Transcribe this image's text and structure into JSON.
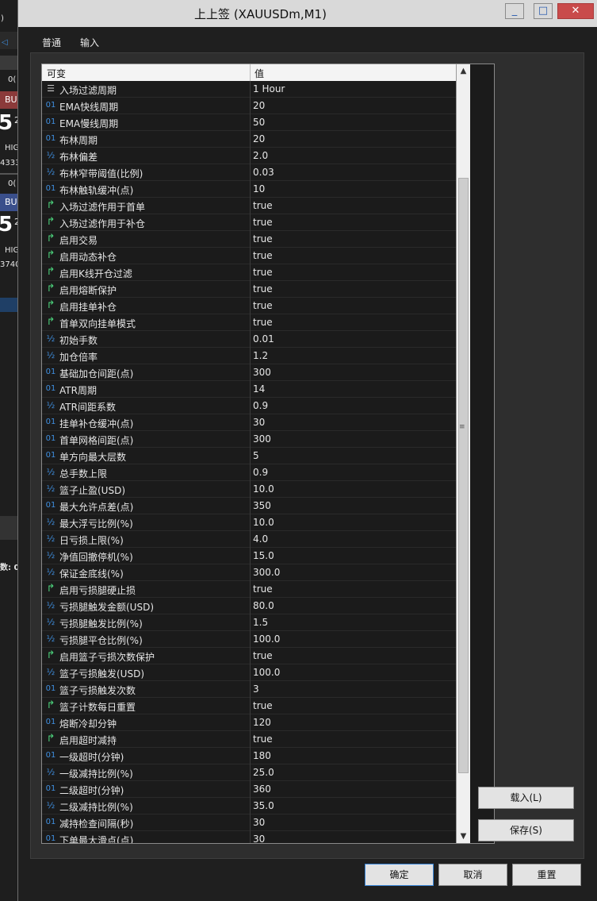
{
  "window": {
    "title": "上上签 (XAUUSDm,M1)",
    "controls": {
      "minimize": "_",
      "maximize": "□",
      "close": "✕"
    }
  },
  "background": {
    "items": [
      ")",
      "0(",
      "BU",
      "5",
      "2",
      "HIG",
      "4333",
      "0(",
      "BU",
      "5",
      "2",
      "HIG",
      "3740",
      "数: 0"
    ]
  },
  "tabs": [
    {
      "label": "普通"
    },
    {
      "label": "输入"
    }
  ],
  "grid": {
    "headers": {
      "name": "可变",
      "value": "值"
    },
    "rows": [
      {
        "icon": "enum",
        "name": "入场过滤周期",
        "value": "1 Hour"
      },
      {
        "icon": "int",
        "name": "EMA快线周期",
        "value": "20"
      },
      {
        "icon": "int",
        "name": "EMA慢线周期",
        "value": "50"
      },
      {
        "icon": "int",
        "name": "布林周期",
        "value": "20"
      },
      {
        "icon": "double",
        "name": "布林偏差",
        "value": "2.0"
      },
      {
        "icon": "double",
        "name": "布林窄带阈值(比例)",
        "value": "0.03"
      },
      {
        "icon": "int",
        "name": "布林触轨缓冲(点)",
        "value": "10"
      },
      {
        "icon": "bool",
        "name": "入场过滤作用于首单",
        "value": "true"
      },
      {
        "icon": "bool",
        "name": "入场过滤作用于补仓",
        "value": "true"
      },
      {
        "icon": "bool",
        "name": "启用交易",
        "value": "true"
      },
      {
        "icon": "bool",
        "name": "启用动态补仓",
        "value": "true"
      },
      {
        "icon": "bool",
        "name": "启用K线开仓过滤",
        "value": "true"
      },
      {
        "icon": "bool",
        "name": "启用熔断保护",
        "value": "true"
      },
      {
        "icon": "bool",
        "name": "启用挂单补仓",
        "value": "true"
      },
      {
        "icon": "bool",
        "name": "首单双向挂单模式",
        "value": "true"
      },
      {
        "icon": "double",
        "name": "初始手数",
        "value": "0.01"
      },
      {
        "icon": "double",
        "name": "加仓倍率",
        "value": "1.2"
      },
      {
        "icon": "int",
        "name": "基础加仓间距(点)",
        "value": "300"
      },
      {
        "icon": "int",
        "name": "ATR周期",
        "value": "14"
      },
      {
        "icon": "double",
        "name": "ATR间距系数",
        "value": "0.9"
      },
      {
        "icon": "int",
        "name": "挂单补仓缓冲(点)",
        "value": "30"
      },
      {
        "icon": "int",
        "name": "首单网格间距(点)",
        "value": "300"
      },
      {
        "icon": "int",
        "name": "单方向最大层数",
        "value": "5"
      },
      {
        "icon": "double",
        "name": "总手数上限",
        "value": "0.9"
      },
      {
        "icon": "double",
        "name": "篮子止盈(USD)",
        "value": "10.0"
      },
      {
        "icon": "int",
        "name": "最大允许点差(点)",
        "value": "350"
      },
      {
        "icon": "double",
        "name": "最大浮亏比例(%)",
        "value": "10.0"
      },
      {
        "icon": "double",
        "name": "日亏损上限(%)",
        "value": "4.0"
      },
      {
        "icon": "double",
        "name": "净值回撤停机(%)",
        "value": "15.0"
      },
      {
        "icon": "double",
        "name": "保证金底线(%)",
        "value": "300.0"
      },
      {
        "icon": "bool",
        "name": "启用亏损腿硬止损",
        "value": "true"
      },
      {
        "icon": "double",
        "name": "亏损腿触发金额(USD)",
        "value": "80.0"
      },
      {
        "icon": "double",
        "name": "亏损腿触发比例(%)",
        "value": "1.5"
      },
      {
        "icon": "double",
        "name": "亏损腿平仓比例(%)",
        "value": "100.0"
      },
      {
        "icon": "bool",
        "name": "启用篮子亏损次数保护",
        "value": "true"
      },
      {
        "icon": "double",
        "name": "篮子亏损触发(USD)",
        "value": "100.0"
      },
      {
        "icon": "int",
        "name": "篮子亏损触发次数",
        "value": "3"
      },
      {
        "icon": "bool",
        "name": "篮子计数每日重置",
        "value": "true"
      },
      {
        "icon": "int",
        "name": "熔断冷却分钟",
        "value": "120"
      },
      {
        "icon": "bool",
        "name": "启用超时减持",
        "value": "true"
      },
      {
        "icon": "int",
        "name": "一级超时(分钟)",
        "value": "180"
      },
      {
        "icon": "double",
        "name": "一级减持比例(%)",
        "value": "25.0"
      },
      {
        "icon": "int",
        "name": "二级超时(分钟)",
        "value": "360"
      },
      {
        "icon": "double",
        "name": "二级减持比例(%)",
        "value": "35.0"
      },
      {
        "icon": "int",
        "name": "减持检查间隔(秒)",
        "value": "30"
      },
      {
        "icon": "int",
        "name": "下单最大滑点(点)",
        "value": "30"
      }
    ],
    "icon_glyphs": {
      "int": "01",
      "double": "½",
      "bool": "↱",
      "enum": "☰"
    },
    "scroll": {
      "up": "▲",
      "down": "▼",
      "grip": "≡"
    }
  },
  "buttons": {
    "load": "载入(L)",
    "save": "保存(S)",
    "ok": "确定",
    "cancel": "取消",
    "reset": "重置"
  },
  "colors": {
    "accent": "#3a86d8",
    "bool_icon": "#4bd07a",
    "num_icon": "#3f8fe0",
    "close": "#c94b4b"
  }
}
